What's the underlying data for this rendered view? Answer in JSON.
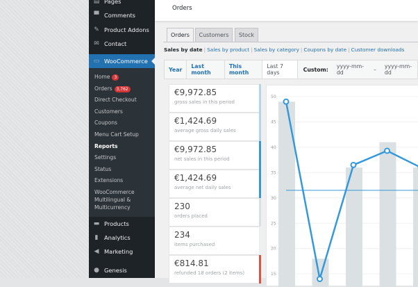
{
  "sidebar": {
    "top_items": [
      {
        "label": "Pages",
        "icon": "pages-icon"
      },
      {
        "label": "Comments",
        "icon": "comment-icon"
      },
      {
        "label": "Product Addons",
        "icon": "clipboard-icon"
      },
      {
        "label": "Contact",
        "icon": "mail-icon"
      }
    ],
    "woocommerce": "WooCommerce",
    "sub_items": [
      {
        "label": "Home",
        "badge": "3"
      },
      {
        "label": "Orders",
        "badge": "3,762"
      },
      {
        "label": "Direct Checkout"
      },
      {
        "label": "Customers"
      },
      {
        "label": "Coupons"
      },
      {
        "label": "Menu Cart Setup"
      },
      {
        "label": "Reports",
        "current": true
      },
      {
        "label": "Settings"
      },
      {
        "label": "Status"
      },
      {
        "label": "Extensions"
      },
      {
        "label": "WooCommerce"
      },
      {
        "label": "Multilingual &"
      },
      {
        "label": "Multicurrency"
      }
    ],
    "bottom_items": [
      {
        "label": "Products",
        "icon": "archive-icon"
      },
      {
        "label": "Analytics",
        "icon": "bar-chart-icon"
      },
      {
        "label": "Marketing",
        "icon": "megaphone-icon"
      },
      {
        "label": "Genesis",
        "icon": "genesis-icon"
      }
    ]
  },
  "header": {
    "title": "Orders"
  },
  "tabs": [
    "Orders",
    "Customers",
    "Stock"
  ],
  "subnav": [
    "Sales by date",
    "Sales by product",
    "Sales by category",
    "Coupons by date",
    "Customer downloads"
  ],
  "ranges": [
    "Year",
    "Last month",
    "This month",
    "Last 7 days"
  ],
  "custom": {
    "label": "Custom:",
    "from_placeholder": "yyyy-mm-dd",
    "dash": "–",
    "to_placeholder": "yyyy-mm-dd"
  },
  "colors": {
    "accent": "#2271b1",
    "line": "#3498db",
    "bar": "#dbe1e3",
    "refund": "#e74c3c"
  },
  "stats": [
    {
      "value": "€9,972.85",
      "desc": "gross sales in this period",
      "color": "#b1d4ea"
    },
    {
      "value": "€1,424.69",
      "desc": "average gross daily sales",
      "color": "#b1d4ea"
    },
    {
      "value": "€9,972.85",
      "desc": "net sales in this period",
      "color": "#3498db"
    },
    {
      "value": "€1,424.69",
      "desc": "average net daily sales",
      "color": "#3498db"
    },
    {
      "value": "230",
      "desc": "orders placed",
      "color": "#dbe1e3"
    },
    {
      "value": "234",
      "desc": "items purchased",
      "color": "#ecf0f1"
    },
    {
      "value": "€814.81",
      "desc": "refunded 18 orders (2 items)",
      "color": "#e74c3c"
    }
  ],
  "chart_data": {
    "type": "bar",
    "yticks": [
      "50",
      "45",
      "40",
      "35",
      "30",
      "25",
      "20",
      "15"
    ],
    "ylim": [
      13,
      51
    ],
    "bars": [
      49,
      18,
      36,
      41,
      36
    ],
    "line": [
      49,
      14,
      36.5,
      39.3,
      36
    ],
    "average": 31.5
  }
}
